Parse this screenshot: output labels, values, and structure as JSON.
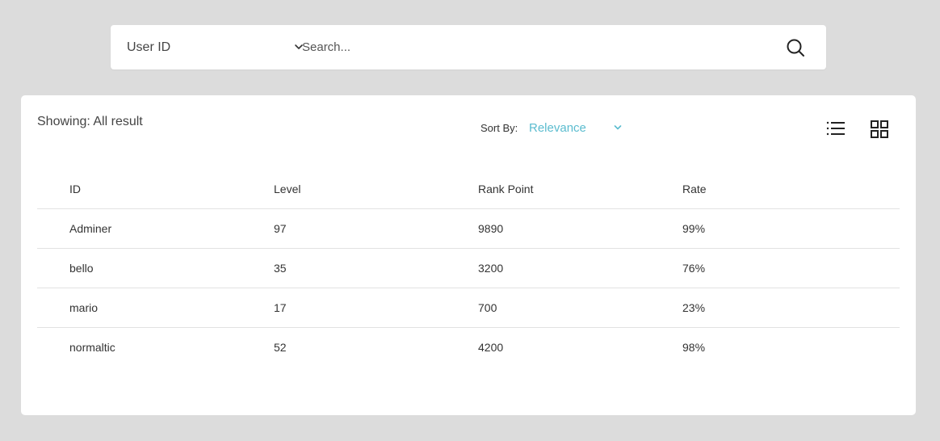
{
  "search": {
    "field_selected": "User ID",
    "placeholder": "Search..."
  },
  "results": {
    "showing_text": "Showing: All result",
    "sort_label": "Sort By:",
    "sort_selected": "Relevance"
  },
  "table": {
    "headers": [
      "ID",
      "Level",
      "Rank Point",
      "Rate"
    ],
    "rows": [
      [
        "Adminer",
        "97",
        "9890",
        "99%"
      ],
      [
        "bello",
        "35",
        "3200",
        "76%"
      ],
      [
        "mario",
        "17",
        "700",
        "23%"
      ],
      [
        "normaltic",
        "52",
        "4200",
        "98%"
      ]
    ]
  },
  "colors": {
    "background": "#dcdcdc",
    "panel": "#ffffff",
    "accent": "#5bbccf"
  },
  "icons": {
    "search": "search-icon",
    "list_view": "list-view-icon",
    "grid_view": "grid-view-icon",
    "dropdown": "chevron-down-icon"
  }
}
